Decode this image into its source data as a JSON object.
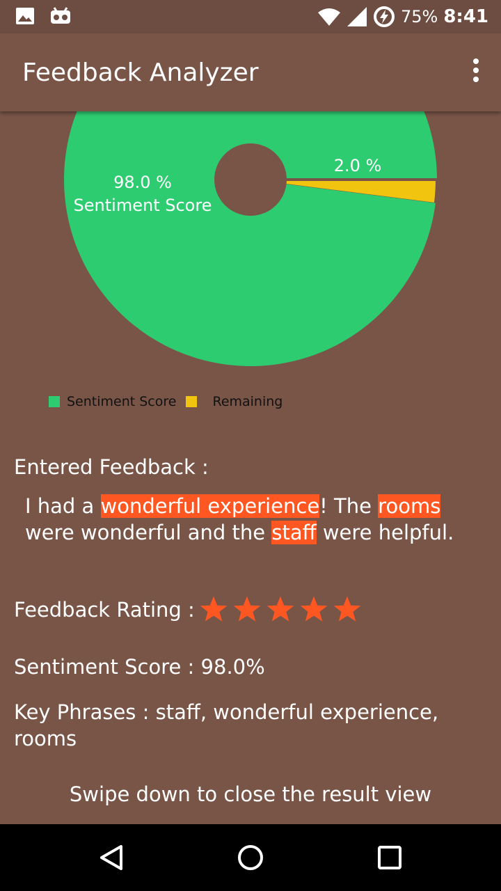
{
  "status_bar": {
    "battery": "75%",
    "time": "8:41",
    "icons": [
      "image-icon",
      "voicemail-icon",
      "wifi-icon",
      "signal-icon",
      "battery-charging-icon"
    ]
  },
  "app_bar": {
    "title": "Feedback Analyzer",
    "menu_icon": "more-vert-icon"
  },
  "chart_data": {
    "type": "pie",
    "categories": [
      "Sentiment Score",
      "Remaining"
    ],
    "values": [
      98.0,
      2.0
    ],
    "slice_labels": [
      "98.0 %",
      "2.0 %"
    ],
    "center_label_value": "98.0 %",
    "center_label_name": "Sentiment Score",
    "colors": [
      "#2ecc71",
      "#f1c40f"
    ],
    "legend": [
      "Sentiment Score",
      "Remaining"
    ],
    "legend_position": "bottom-left"
  },
  "feedback": {
    "heading": "Entered Feedback :",
    "segments": [
      {
        "text": "I had a ",
        "highlight": false
      },
      {
        "text": "wonderful experience",
        "highlight": true
      },
      {
        "text": "! The ",
        "highlight": false
      },
      {
        "text": "rooms",
        "highlight": true
      },
      {
        "text": " were wonderful and the ",
        "highlight": false
      },
      {
        "text": "staff",
        "highlight": true
      },
      {
        "text": " were helpful.",
        "highlight": false
      }
    ],
    "highlight_color": "#ff5722"
  },
  "rating": {
    "label": "Feedback Rating :",
    "stars": 5,
    "max_stars": 5,
    "star_color": "#ff5722"
  },
  "sentiment": {
    "label": "Sentiment Score : 98.0%"
  },
  "key_phrases": {
    "label": "Key Phrases : staff, wonderful experience, rooms"
  },
  "hint": "Swipe down to close the result view",
  "nav_bar": [
    "back-icon",
    "home-icon",
    "recents-icon"
  ]
}
